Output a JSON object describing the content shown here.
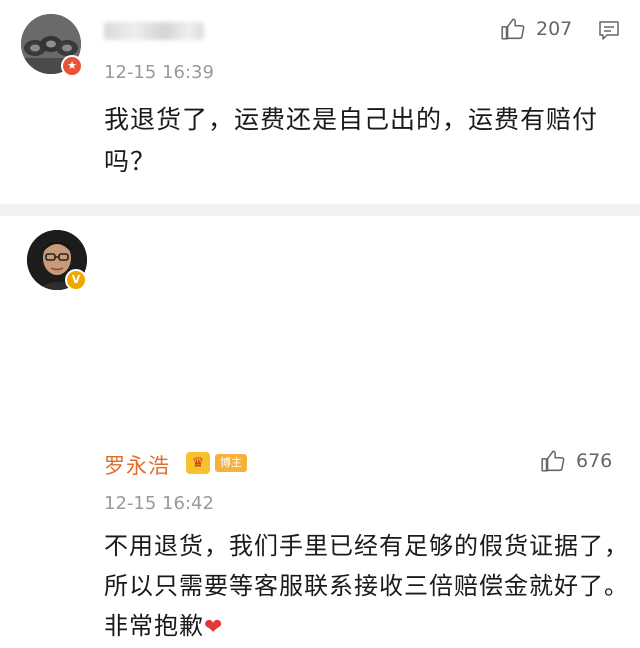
{
  "comment1": {
    "avatar": "tires-photo-avatar",
    "badge": "★",
    "time": "12-15 16:39",
    "text": "我退货了，运费还是自己出的，运费有赔付吗？",
    "likes": "207"
  },
  "comment2": {
    "username": "罗永浩",
    "crown": "♛",
    "poster_tag": "博主",
    "badge": "V",
    "time": "12-15 16:42",
    "text": "不用退货，我们手里已经有足够的假货证据了，所以只需要等客服联系接收三倍赔偿金就好了。非常抱歉",
    "heart": "❤",
    "likes": "676"
  },
  "colors": {
    "username": "#e86b28",
    "time": "#9a9a9a",
    "heart": "#e53935",
    "separator": "#f2f2f2"
  },
  "icons": {
    "like": "thumbs-up-icon",
    "reply": "comment-bubble-icon"
  }
}
